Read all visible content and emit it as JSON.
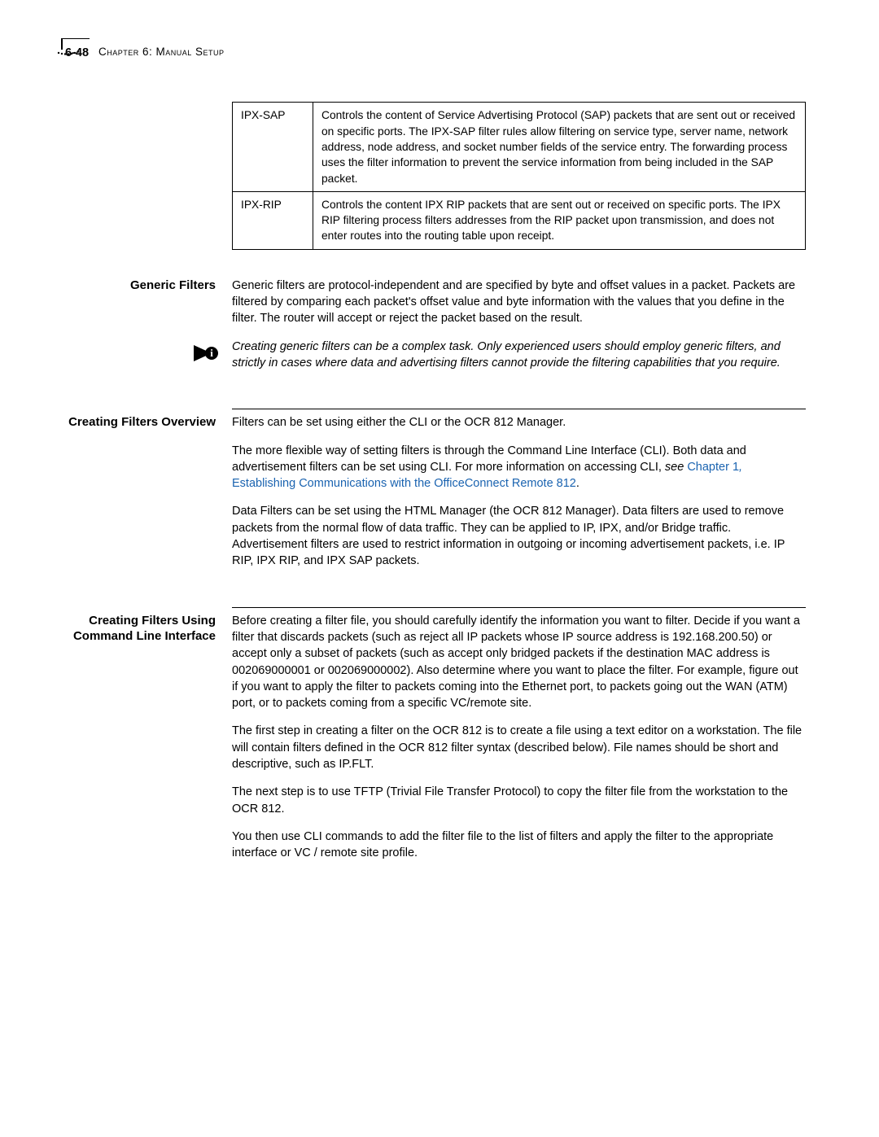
{
  "header": {
    "page_number": "6-48",
    "chapter": "Chapter 6: Manual Setup"
  },
  "table": {
    "rows": [
      {
        "label": "IPX-SAP",
        "desc": "Controls the content of Service Advertising Protocol (SAP) packets that are sent out or received on specific ports. The IPX-SAP filter rules allow filtering on service type, server name, network address, node address, and socket number fields of the service entry. The forwarding process uses the filter information to prevent the service information from being included in the SAP packet."
      },
      {
        "label": "IPX-RIP",
        "desc": "Controls the content IPX RIP packets that are sent out or received on specific ports. The IPX RIP filtering process filters addresses from the RIP packet upon transmission, and does not enter routes into the routing table upon receipt."
      }
    ]
  },
  "generic_filters": {
    "heading": "Generic Filters",
    "para1": "Generic filters are protocol-independent and are specified by byte and offset values in a packet. Packets are filtered by comparing each packet's offset value and byte information with the values that you define in the filter. The router will accept or reject the packet based on the result.",
    "note": "Creating generic filters can be a complex task. Only experienced users should employ generic filters, and strictly in cases where data and advertising filters cannot provide the filtering capabilities that you require."
  },
  "overview": {
    "heading": "Creating Filters Overview",
    "para1": "Filters can be set using either the CLI or the OCR 812 Manager.",
    "para2_a": "The more flexible way of setting filters is through the Command Line Interface (CLI). Both data and advertisement filters can be set using CLI. For more information on accessing CLI, ",
    "para2_see": "see ",
    "para2_link1": "Chapter 1",
    "para2_comma": ", ",
    "para2_link2": "Establishing Communications with the OfficeConnect Remote 812",
    "para2_end": ".",
    "para3": "Data Filters can be set using the HTML Manager (the OCR 812 Manager). Data filters are used to remove packets from the normal flow of data traffic. They can be applied to IP, IPX, and/or Bridge traffic. Advertisement filters are used to restrict information in outgoing or incoming advertisement packets, i.e. IP RIP, IPX RIP, and IPX SAP packets."
  },
  "cli": {
    "heading": "Creating Filters Using Command Line Interface",
    "para1": "Before creating a filter file, you should carefully identify the information you want to filter. Decide if you want a filter that discards packets (such as reject all IP packets whose IP source address is 192.168.200.50) or accept only a subset of packets (such as accept only bridged packets if the destination MAC address is 002069000001 or 002069000002). Also determine where you want to place the filter. For example, figure out if you want to apply the filter to packets coming into the Ethernet port, to packets going out the WAN (ATM) port, or to packets coming from a specific VC/remote site.",
    "para2": "The first step in creating a filter on the OCR 812 is to create a file using a text editor on a workstation. The file will contain filters defined in the OCR 812 filter syntax (described below). File names should be short and descriptive, such as IP.FLT.",
    "para3": "The next step is to use TFTP (Trivial File Transfer Protocol) to copy the filter file from the workstation to the OCR 812.",
    "para4": "You then use CLI commands to add the filter file to the list of filters and apply the filter to the appropriate interface or VC / remote site profile."
  }
}
